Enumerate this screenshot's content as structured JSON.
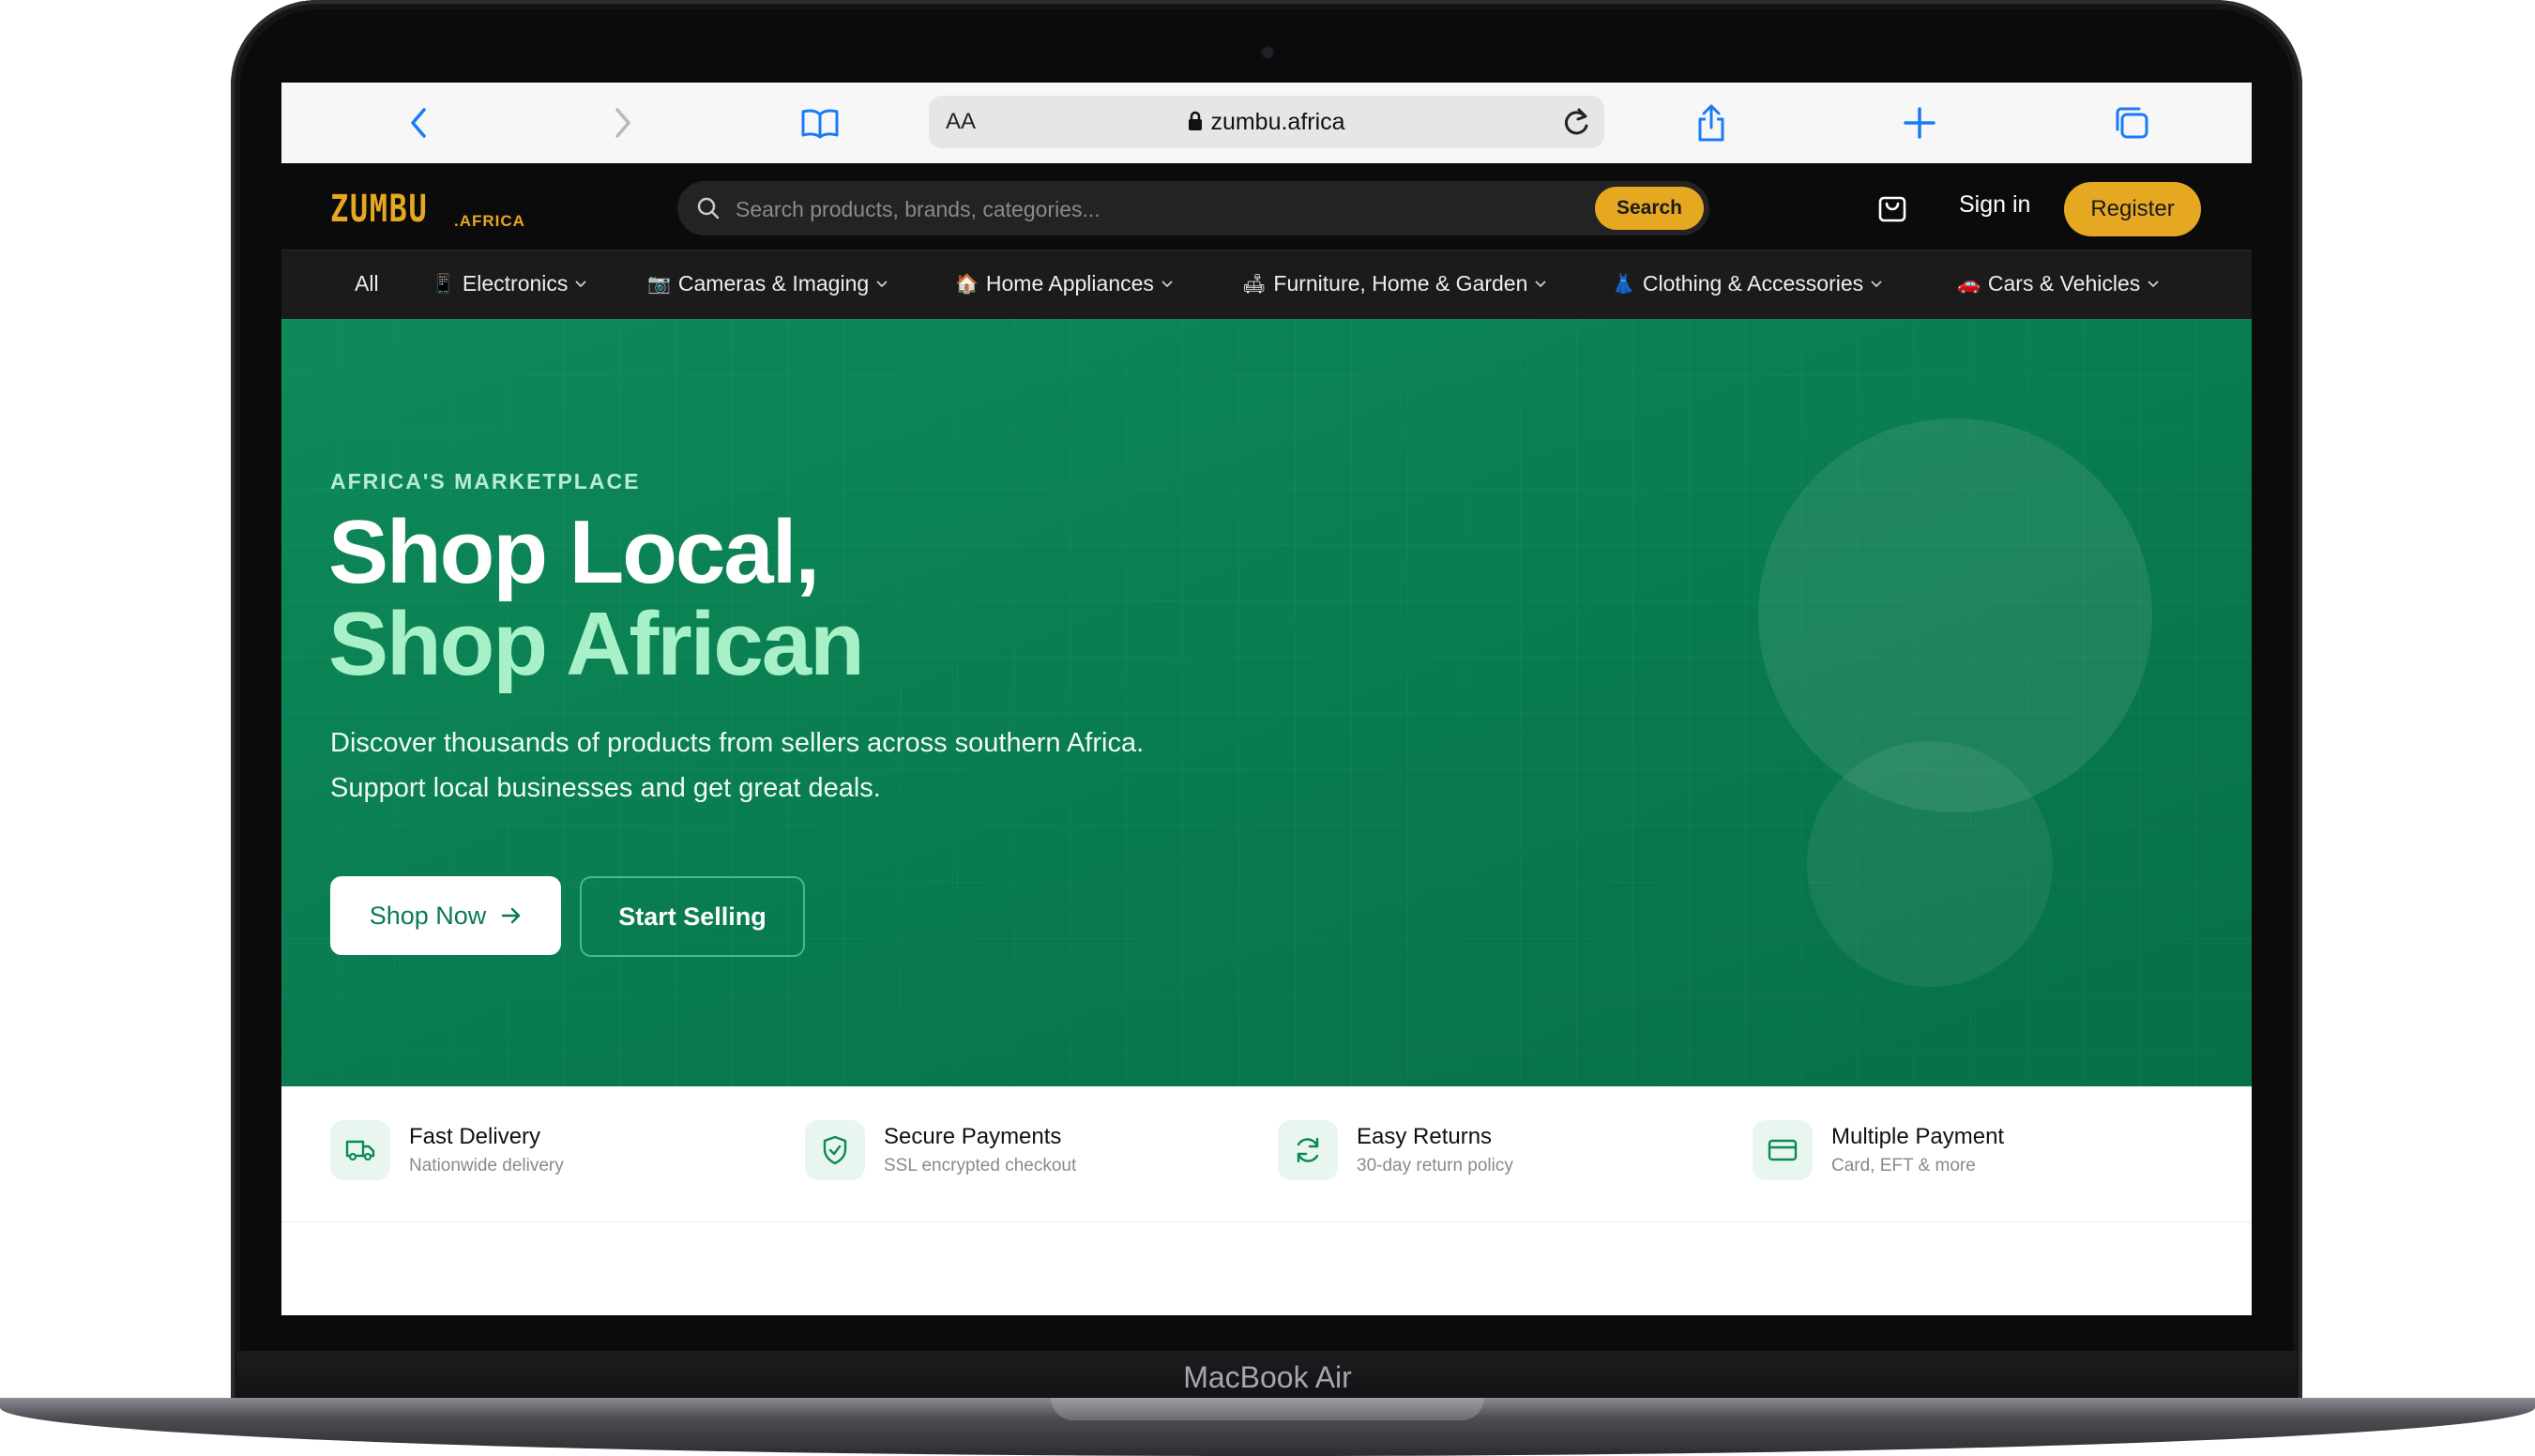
{
  "device": {
    "label": "MacBook Air"
  },
  "browser": {
    "text_size_label": "AA",
    "url": "zumbu.africa"
  },
  "header": {
    "logo_main": "ZUMBU",
    "logo_sub": ".AFRICA",
    "search_placeholder": "Search products, brands, categories...",
    "search_button": "Search",
    "signin": "Sign in",
    "register": "Register"
  },
  "nav": {
    "items": [
      {
        "label": "All",
        "icon": "",
        "has_dropdown": false
      },
      {
        "label": "Electronics",
        "icon": "📱",
        "has_dropdown": true
      },
      {
        "label": "Cameras & Imaging",
        "icon": "📷",
        "has_dropdown": true
      },
      {
        "label": "Home Appliances",
        "icon": "🏠",
        "has_dropdown": true
      },
      {
        "label": "Furniture, Home & Garden",
        "icon": "🛋",
        "has_dropdown": true
      },
      {
        "label": "Clothing & Accessories",
        "icon": "👗",
        "has_dropdown": true
      },
      {
        "label": "Cars & Vehicles",
        "icon": "🚗",
        "has_dropdown": true
      }
    ]
  },
  "hero": {
    "eyebrow": "AFRICA'S MARKETPLACE",
    "title_line1": "Shop Local,",
    "title_line2": "Shop African",
    "description_line1": "Discover thousands of products from sellers across southern Africa.",
    "description_line2": "Support local businesses and get great deals.",
    "primary_cta": "Shop Now",
    "secondary_cta": "Start Selling"
  },
  "features": [
    {
      "title": "Fast Delivery",
      "subtitle": "Nationwide delivery",
      "icon": "truck-icon"
    },
    {
      "title": "Secure Payments",
      "subtitle": "SSL encrypted checkout",
      "icon": "shield-check-icon"
    },
    {
      "title": "Easy Returns",
      "subtitle": "30-day return policy",
      "icon": "refresh-icon"
    },
    {
      "title": "Multiple Payment",
      "subtitle": "Card, EFT & more",
      "icon": "credit-card-icon"
    }
  ],
  "colors": {
    "accent": "#e6a721",
    "hero_green": "#0a7d50",
    "hero_highlight": "#a8f0c8",
    "header_bg": "#0b0b0b"
  }
}
